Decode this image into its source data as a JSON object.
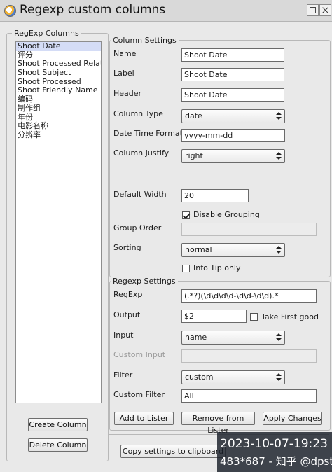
{
  "window": {
    "title": "Regexp custom columns"
  },
  "columns_panel": {
    "title": "RegExp Columns",
    "items": [
      "Shoot Date",
      "评分",
      "Shoot Processed Relative",
      "Shoot Subject",
      "Shoot Processed",
      "Shoot Friendly Name",
      "编码",
      "制作组",
      "年份",
      "电影名称",
      "分辨率"
    ],
    "selected_index": 0,
    "create_label": "Create Column",
    "delete_label": "Delete Column"
  },
  "column_settings": {
    "title": "Column Settings",
    "name_label": "Name",
    "name_value": "Shoot Date",
    "label_label": "Label",
    "label_value": "Shoot Date",
    "header_label": "Header",
    "header_value": "Shoot Date",
    "type_label": "Column Type",
    "type_value": "date",
    "datefmt_label": "Date Time Format",
    "datefmt_value": "yyyy-mm-dd",
    "justify_label": "Column Justify",
    "justify_value": "right",
    "width_label": "Default Width",
    "width_value": "20",
    "disable_grouping_label": "Disable Grouping",
    "disable_grouping_checked": true,
    "group_order_label": "Group Order",
    "group_order_value": "",
    "sorting_label": "Sorting",
    "sorting_value": "normal",
    "infotip_label": "Info Tip only",
    "infotip_checked": false
  },
  "regexp_settings": {
    "title": "Regexp Settings",
    "regexp_label": "RegExp",
    "regexp_value": "(.*?)(\\d\\d\\d\\d-\\d\\d-\\d\\d).*",
    "output_label": "Output",
    "output_value": "$2",
    "take_first_label": "Take First good",
    "take_first_checked": false,
    "input_label": "Input",
    "input_value": "name",
    "custom_input_label": "Custom Input",
    "custom_input_value": "",
    "filter_label": "Filter",
    "filter_value": "custom",
    "custom_filter_label": "Custom Filter",
    "custom_filter_value": "All"
  },
  "actions": {
    "add_label": "Add to Lister",
    "remove_label": "Remove from Lister",
    "apply_label": "Apply Changes",
    "copy_label": "Copy settings to clipboard"
  },
  "overlay": {
    "timestamp": "2023-10-07-19:23",
    "info": "483*687 - 知乎 @dpst"
  },
  "colors": {
    "selection": "#d4dcf6",
    "background": "#e9e9e9",
    "overlay": "#191e28"
  }
}
